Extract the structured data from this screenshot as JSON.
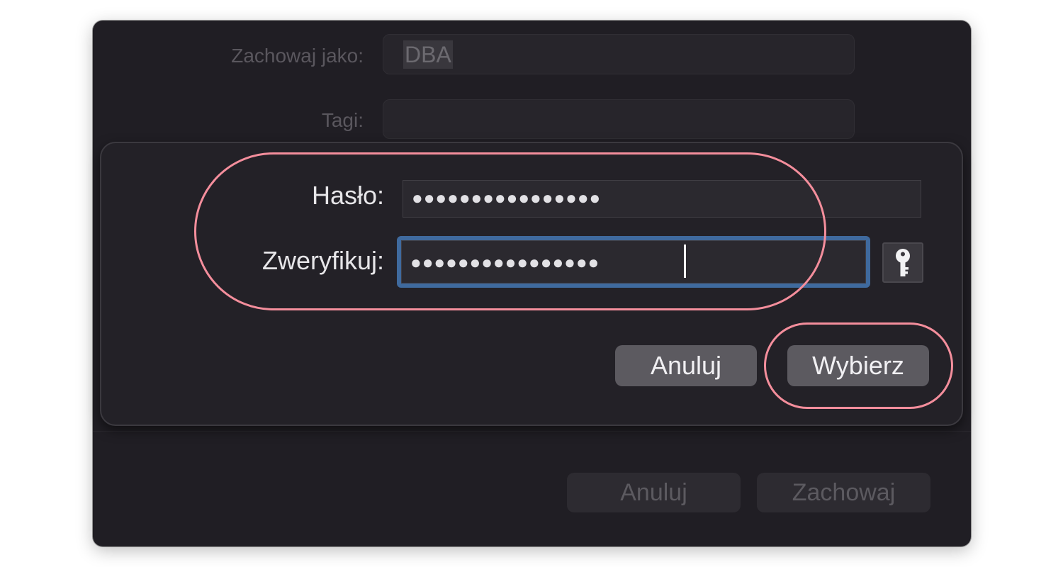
{
  "save_dialog": {
    "save_as_label": "Zachowaj jako:",
    "save_as_value": "DBA",
    "tags_label": "Tagi:",
    "tags_value": "",
    "cancel_label": "Anuluj",
    "save_label": "Zachowaj"
  },
  "password_sheet": {
    "password_label": "Hasło:",
    "password_value": "●●●●●●●●●●●●●●●●",
    "verify_label": "Zweryfikuj:",
    "verify_value": "●●●●●●●●●●●●●●●●",
    "key_icon": "key-icon",
    "cancel_label": "Anuluj",
    "choose_label": "Wybierz"
  },
  "annotations": {
    "color": "#f48e9c"
  },
  "colors": {
    "window_bg": "#201e24",
    "sheet_bg": "#232127",
    "focus_ring": "#3f6a9e",
    "button_bg": "#5c5a60"
  }
}
